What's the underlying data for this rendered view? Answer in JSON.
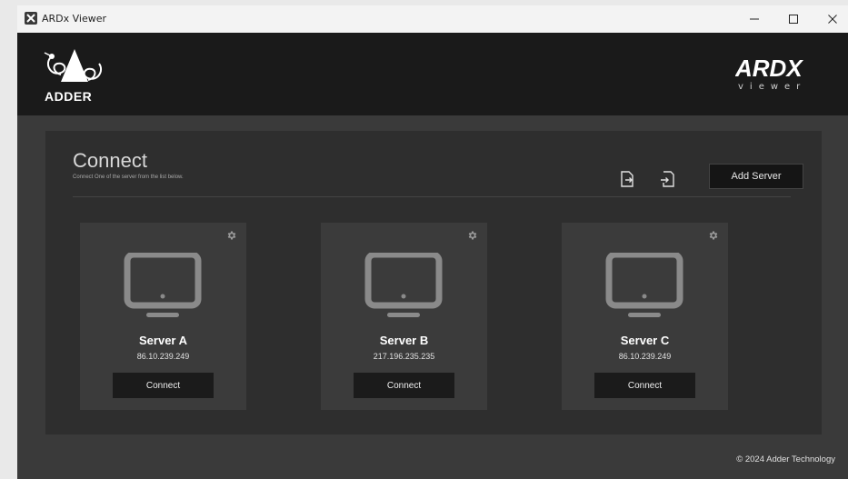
{
  "window": {
    "title": "ARDx Viewer",
    "icons": [
      "app-icon",
      "minimize-icon",
      "maximize-icon",
      "close-icon"
    ]
  },
  "header": {
    "brand_left": "ADDER",
    "brand_right": "ARDX",
    "brand_right_sub": "viewer"
  },
  "connect": {
    "title": "Connect",
    "subtitle": "Connect One of the server from the list below.",
    "toolbar": {
      "export_icon": "file-export-icon",
      "import_icon": "file-import-icon",
      "add_server_label": "Add Server"
    }
  },
  "servers": [
    {
      "name": "Server A",
      "ip": "86.10.239.249",
      "connect_label": "Connect"
    },
    {
      "name": "Server B",
      "ip": "217.196.235.235",
      "connect_label": "Connect"
    },
    {
      "name": "Server C",
      "ip": "86.10.239.249",
      "connect_label": "Connect"
    }
  ],
  "footer": {
    "copyright": "© 2024 Adder Technology"
  },
  "colors": {
    "titlebar_bg": "#f3f3f3",
    "header_bg": "#1a1a1a",
    "window_bg": "#3a3a3a",
    "panel_bg": "#2e2e2e",
    "card_bg": "#3b3b3b",
    "button_bg": "#1b1b1b",
    "icon_gray": "#8a8a8a"
  }
}
